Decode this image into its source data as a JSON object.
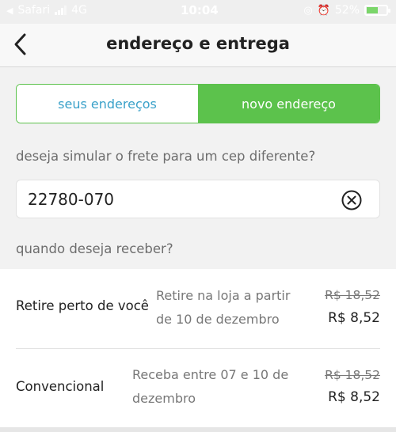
{
  "status_bar": {
    "back_app": "Safari",
    "network": "4G",
    "time": "10:04",
    "battery": "52%",
    "battery_level": 0.52
  },
  "header": {
    "title": "endereço e entrega"
  },
  "tabs": [
    {
      "label": "seus endereços",
      "selected": false
    },
    {
      "label": "novo endereço",
      "selected": true
    }
  ],
  "cep": {
    "question": "deseja simular o frete para um cep diferente?",
    "value": "22780-070"
  },
  "delivery": {
    "question": "quando deseja receber?",
    "options": [
      {
        "name": "Retire perto de você",
        "desc_line1": "Retire na loja a partir",
        "desc_line2": "de 10 de dezembro",
        "old_price": "R$ 18,52",
        "price": "R$ 8,52"
      },
      {
        "name": "Convencional",
        "desc_line1": "Receba entre 07 e 10 de",
        "desc_line2": "dezembro",
        "old_price": "R$ 18,52",
        "price": "R$ 8,52"
      }
    ]
  },
  "colors": {
    "accent_green": "#5cc24c",
    "link_blue": "#3aa1c9"
  }
}
